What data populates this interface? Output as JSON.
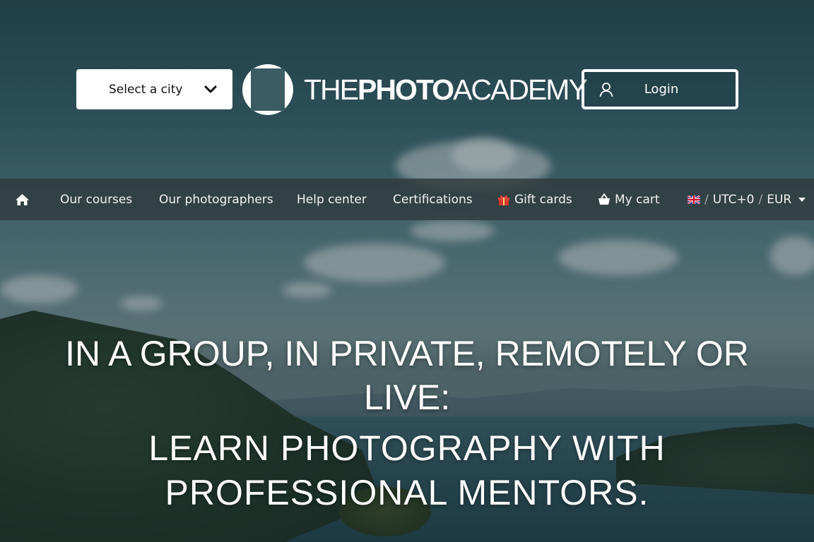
{
  "header": {
    "city_select": {
      "label": "Select a city"
    },
    "logo": {
      "part1": "THE",
      "part2": "PHOTO",
      "part3": "ACADEMY"
    },
    "login_label": "Login"
  },
  "nav": {
    "items": [
      {
        "label": "Our courses"
      },
      {
        "label": "Our photographers"
      },
      {
        "label": "Help center"
      },
      {
        "label": "Certifications"
      },
      {
        "label": "Gift cards"
      },
      {
        "label": "My cart"
      }
    ],
    "locale": {
      "sep": "/",
      "timezone": "UTC+0",
      "currency": "EUR"
    }
  },
  "hero": {
    "title": "IN A GROUP, IN PRIVATE, REMOTELY OR LIVE:",
    "subtitle": "LEARN PHOTOGRAPHY WITH PROFESSIONAL MENTORS."
  },
  "icons": {
    "home": "home-icon",
    "gift": "gift-icon",
    "cart": "basket-icon",
    "flag": "uk-flag-icon",
    "user": "user-icon",
    "chevron": "chevron-down-icon"
  },
  "colors": {
    "nav_bg": "#303a3c",
    "text": "#ffffff",
    "gift_red": "#d9352c"
  }
}
